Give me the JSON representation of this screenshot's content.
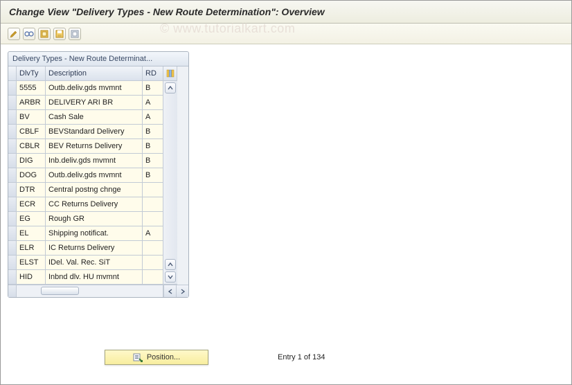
{
  "header": {
    "title": "Change View \"Delivery Types - New Route Determination\": Overview"
  },
  "toolbar": {
    "items": [
      {
        "name": "display-change-icon",
        "glyph": "pencil"
      },
      {
        "name": "glasses-icon",
        "glyph": "glasses"
      },
      {
        "name": "select-all-icon",
        "glyph": "select-all"
      },
      {
        "name": "save-icon",
        "glyph": "save"
      },
      {
        "name": "deselect-icon",
        "glyph": "deselect"
      }
    ]
  },
  "watermark": "© www.tutorialkart.com",
  "table": {
    "caption": "Delivery Types - New Route Determinat...",
    "columns": [
      "DlvTy",
      "Description",
      "RD"
    ],
    "settings_icon": "columns-icon",
    "rows": [
      {
        "dlvty": "5555",
        "desc": "Outb.deliv.gds mvmnt",
        "rd": "B"
      },
      {
        "dlvty": "ARBR",
        "desc": "DELIVERY ARI BR",
        "rd": "A"
      },
      {
        "dlvty": "BV",
        "desc": "Cash Sale",
        "rd": "A"
      },
      {
        "dlvty": "CBLF",
        "desc": "BEVStandard Delivery",
        "rd": "B"
      },
      {
        "dlvty": "CBLR",
        "desc": "BEV Returns Delivery",
        "rd": "B"
      },
      {
        "dlvty": "DIG",
        "desc": "Inb.deliv.gds mvmnt",
        "rd": "B"
      },
      {
        "dlvty": "DOG",
        "desc": "Outb.deliv.gds mvmnt",
        "rd": "B"
      },
      {
        "dlvty": "DTR",
        "desc": "Central postng chnge",
        "rd": ""
      },
      {
        "dlvty": "ECR",
        "desc": "CC Returns Delivery",
        "rd": ""
      },
      {
        "dlvty": "EG",
        "desc": "Rough GR",
        "rd": ""
      },
      {
        "dlvty": "EL",
        "desc": "Shipping notificat.",
        "rd": "A"
      },
      {
        "dlvty": "ELR",
        "desc": "IC Returns Delivery",
        "rd": ""
      },
      {
        "dlvty": "ELST",
        "desc": "IDel. Val. Rec. SiT",
        "rd": ""
      },
      {
        "dlvty": "HID",
        "desc": "Inbnd dlv. HU mvmnt",
        "rd": ""
      }
    ]
  },
  "footer": {
    "position_label": "Position...",
    "entry_text": "Entry 1 of 134"
  }
}
